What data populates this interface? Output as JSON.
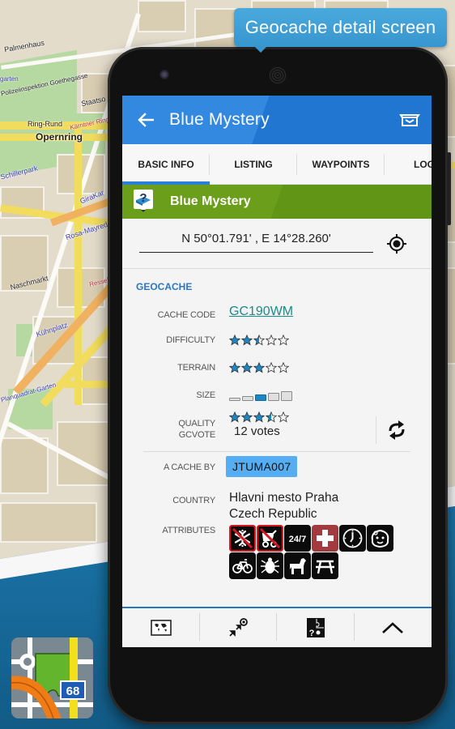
{
  "callout": {
    "text": "Geocache detail screen"
  },
  "background_map": {
    "labels": [
      {
        "text": "Palmenhaus",
        "style": "dark"
      },
      {
        "text": "Polizeiinspektion Goethegasse",
        "style": "dark"
      },
      {
        "text": "Staatso",
        "style": "dark"
      },
      {
        "text": "Ring-Rund",
        "style": "dark"
      },
      {
        "text": "Kärntner Ring",
        "style": "red"
      },
      {
        "text": "Opernring",
        "style": "bigdark"
      },
      {
        "text": "Schillerpark",
        "style": "blue"
      },
      {
        "text": "GiraKar",
        "style": "blue"
      },
      {
        "text": "Rosa-Mayred",
        "style": "blue"
      },
      {
        "text": "Naschmarkt",
        "style": "dark"
      },
      {
        "text": "Ressel",
        "style": "red"
      },
      {
        "text": "Kühnplatz",
        "style": "blue"
      },
      {
        "text": "Planquadrat-Garten",
        "style": "blue"
      },
      {
        "text": "garten",
        "style": "blue"
      }
    ]
  },
  "app_logo": {
    "badge": "68"
  },
  "app": {
    "appbar": {
      "title": "Blue Mystery",
      "back_icon": "arrow-left-icon",
      "action_icon": "cache-box-icon"
    },
    "tabs": [
      {
        "label": "BASIC INFO",
        "active": true
      },
      {
        "label": "LISTING",
        "active": false
      },
      {
        "label": "WAYPOINTS",
        "active": false
      },
      {
        "label": "LOG",
        "active": false
      }
    ],
    "cache_header": {
      "name": "Blue Mystery",
      "icon": "mystery-cache-icon",
      "color": "#6a9e1b"
    },
    "coordinates": {
      "value": "N 50°01.791' , E 14°28.260'",
      "gps_icon": "crosshair-icon"
    },
    "section_title": "GEOCACHE",
    "fields": {
      "cache_code": {
        "label": "CACHE CODE",
        "value": "GC190WM"
      },
      "difficulty": {
        "label": "DIFFICULTY",
        "rating": 2.5,
        "max": 5
      },
      "terrain": {
        "label": "TERRAIN",
        "rating": 3,
        "max": 5
      },
      "size": {
        "label": "SIZE",
        "level": 3,
        "max": 5
      },
      "quality": {
        "label_line1": "QUALITY",
        "label_line2": "GCVOTE",
        "rating": 3.5,
        "max": 5,
        "votes": "12 votes"
      },
      "owner": {
        "label": "A CACHE BY",
        "value": "JTUMA007"
      },
      "country": {
        "label": "COUNTRY",
        "line1": "Hlavni mesto Praha",
        "line2": "Czech Republic"
      },
      "attributes": {
        "label": "ATTRIBUTES",
        "items": [
          {
            "name": "no-winter-icon",
            "negated": true
          },
          {
            "name": "no-stroller-icon",
            "negated": true
          },
          {
            "name": "available-24-7-icon",
            "text": "24/7",
            "negated": false
          },
          {
            "name": "first-aid-icon",
            "negated": false
          },
          {
            "name": "takes-less-than-hour-icon",
            "negated": false
          },
          {
            "name": "kid-friendly-icon",
            "negated": false
          },
          {
            "name": "bicycles-icon",
            "negated": false
          },
          {
            "name": "ticks-icon",
            "negated": false
          },
          {
            "name": "dogs-allowed-icon",
            "negated": false
          },
          {
            "name": "picnic-table-icon",
            "negated": false
          }
        ]
      }
    },
    "bottom_bar": [
      {
        "name": "map-icon"
      },
      {
        "name": "navigate-icon"
      },
      {
        "name": "puzzle-icon"
      },
      {
        "name": "chevron-up-icon"
      }
    ],
    "colors": {
      "primary": "#2a7fd8",
      "star_filled": "#2085c4",
      "link": "#1d8a8a",
      "owner_chip": "#55aef3",
      "section_title": "#2d77c0"
    }
  }
}
